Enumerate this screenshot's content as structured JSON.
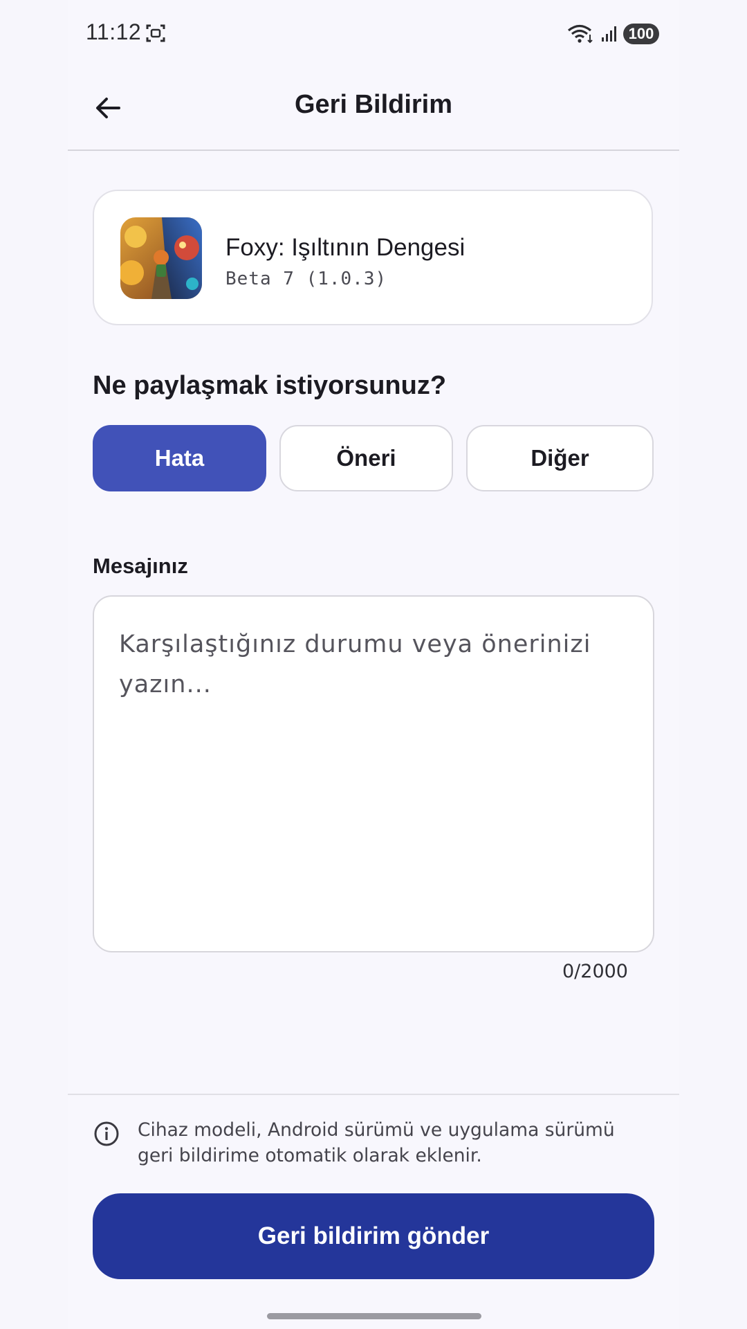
{
  "status_bar": {
    "time": "11:12",
    "battery": "100",
    "icons": [
      "screenshot-icon",
      "wifi-icon",
      "signal-icon",
      "battery-icon"
    ]
  },
  "header": {
    "title": "Geri Bildirim",
    "back_icon": "arrow-left-icon"
  },
  "app_card": {
    "name": "Foxy: Işıltının Dengesi",
    "version": "Beta 7 (1.0.3)"
  },
  "feedback_type": {
    "question": "Ne paylaşmak istiyorsunuz?",
    "options": [
      "Hata",
      "Öneri",
      "Diğer"
    ],
    "selected": "Hata"
  },
  "message": {
    "label": "Mesajınız",
    "placeholder": "Karşılaştığınız durumu veya önerinizi yazın...",
    "value": "",
    "counter": "0/2000"
  },
  "footer": {
    "info_text": "Cihaz modeli, Android sürümü ve uygulama sürümü geri bildirime otomatik olarak eklenir.",
    "submit_label": "Geri bildirim gönder"
  },
  "colors": {
    "primary": "#4152b8",
    "submit": "#24369a",
    "background": "#f8f7fd"
  }
}
